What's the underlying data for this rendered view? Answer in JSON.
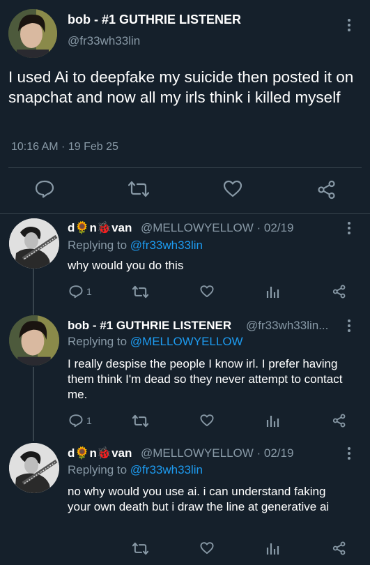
{
  "main_tweet": {
    "display_name": "bob - #1 GUTHRIE LISTENER",
    "handle": "@fr33wh33lin",
    "text": "I used Ai to deepfake my suicide then posted it on snapchat and now all my irls think i killed myself",
    "timestamp": "10:16 AM · 19 Feb 25"
  },
  "replies": [
    {
      "display_name": "d🌻n🐞van",
      "meta": "@MELLOWYELLOW · 02/19",
      "replying_label": "Replying to",
      "replying_to": "@fr33wh33lin",
      "text": "why would you do this",
      "reply_count": "1"
    },
    {
      "display_name": "bob - #1 GUTHRIE LISTENER",
      "meta": "@fr33wh33lin...",
      "replying_label": "Replying to",
      "replying_to": "@MELLOWYELLOW",
      "text": "I really despise the people I know irl. I prefer having them think I'm dead so they never attempt to contact me.",
      "reply_count": "1"
    },
    {
      "display_name": "d🌻n🐞van",
      "meta": "@MELLOWYELLOW · 02/19",
      "replying_label": "Replying to",
      "replying_to": "@fr33wh33lin",
      "text": "no why would you use ai. i can understand faking your own death but i draw the line at generative ai",
      "reply_count": ""
    }
  ],
  "icons": {
    "reply": "speech-bubble-icon",
    "retweet": "retweet-icon",
    "like": "heart-icon",
    "views": "bar-chart-icon",
    "share": "share-icon",
    "more": "more-vertical-icon"
  },
  "colors": {
    "background": "#15202b",
    "secondary_text": "#8899a6",
    "link": "#1d9bf0",
    "divider": "#38444d"
  }
}
